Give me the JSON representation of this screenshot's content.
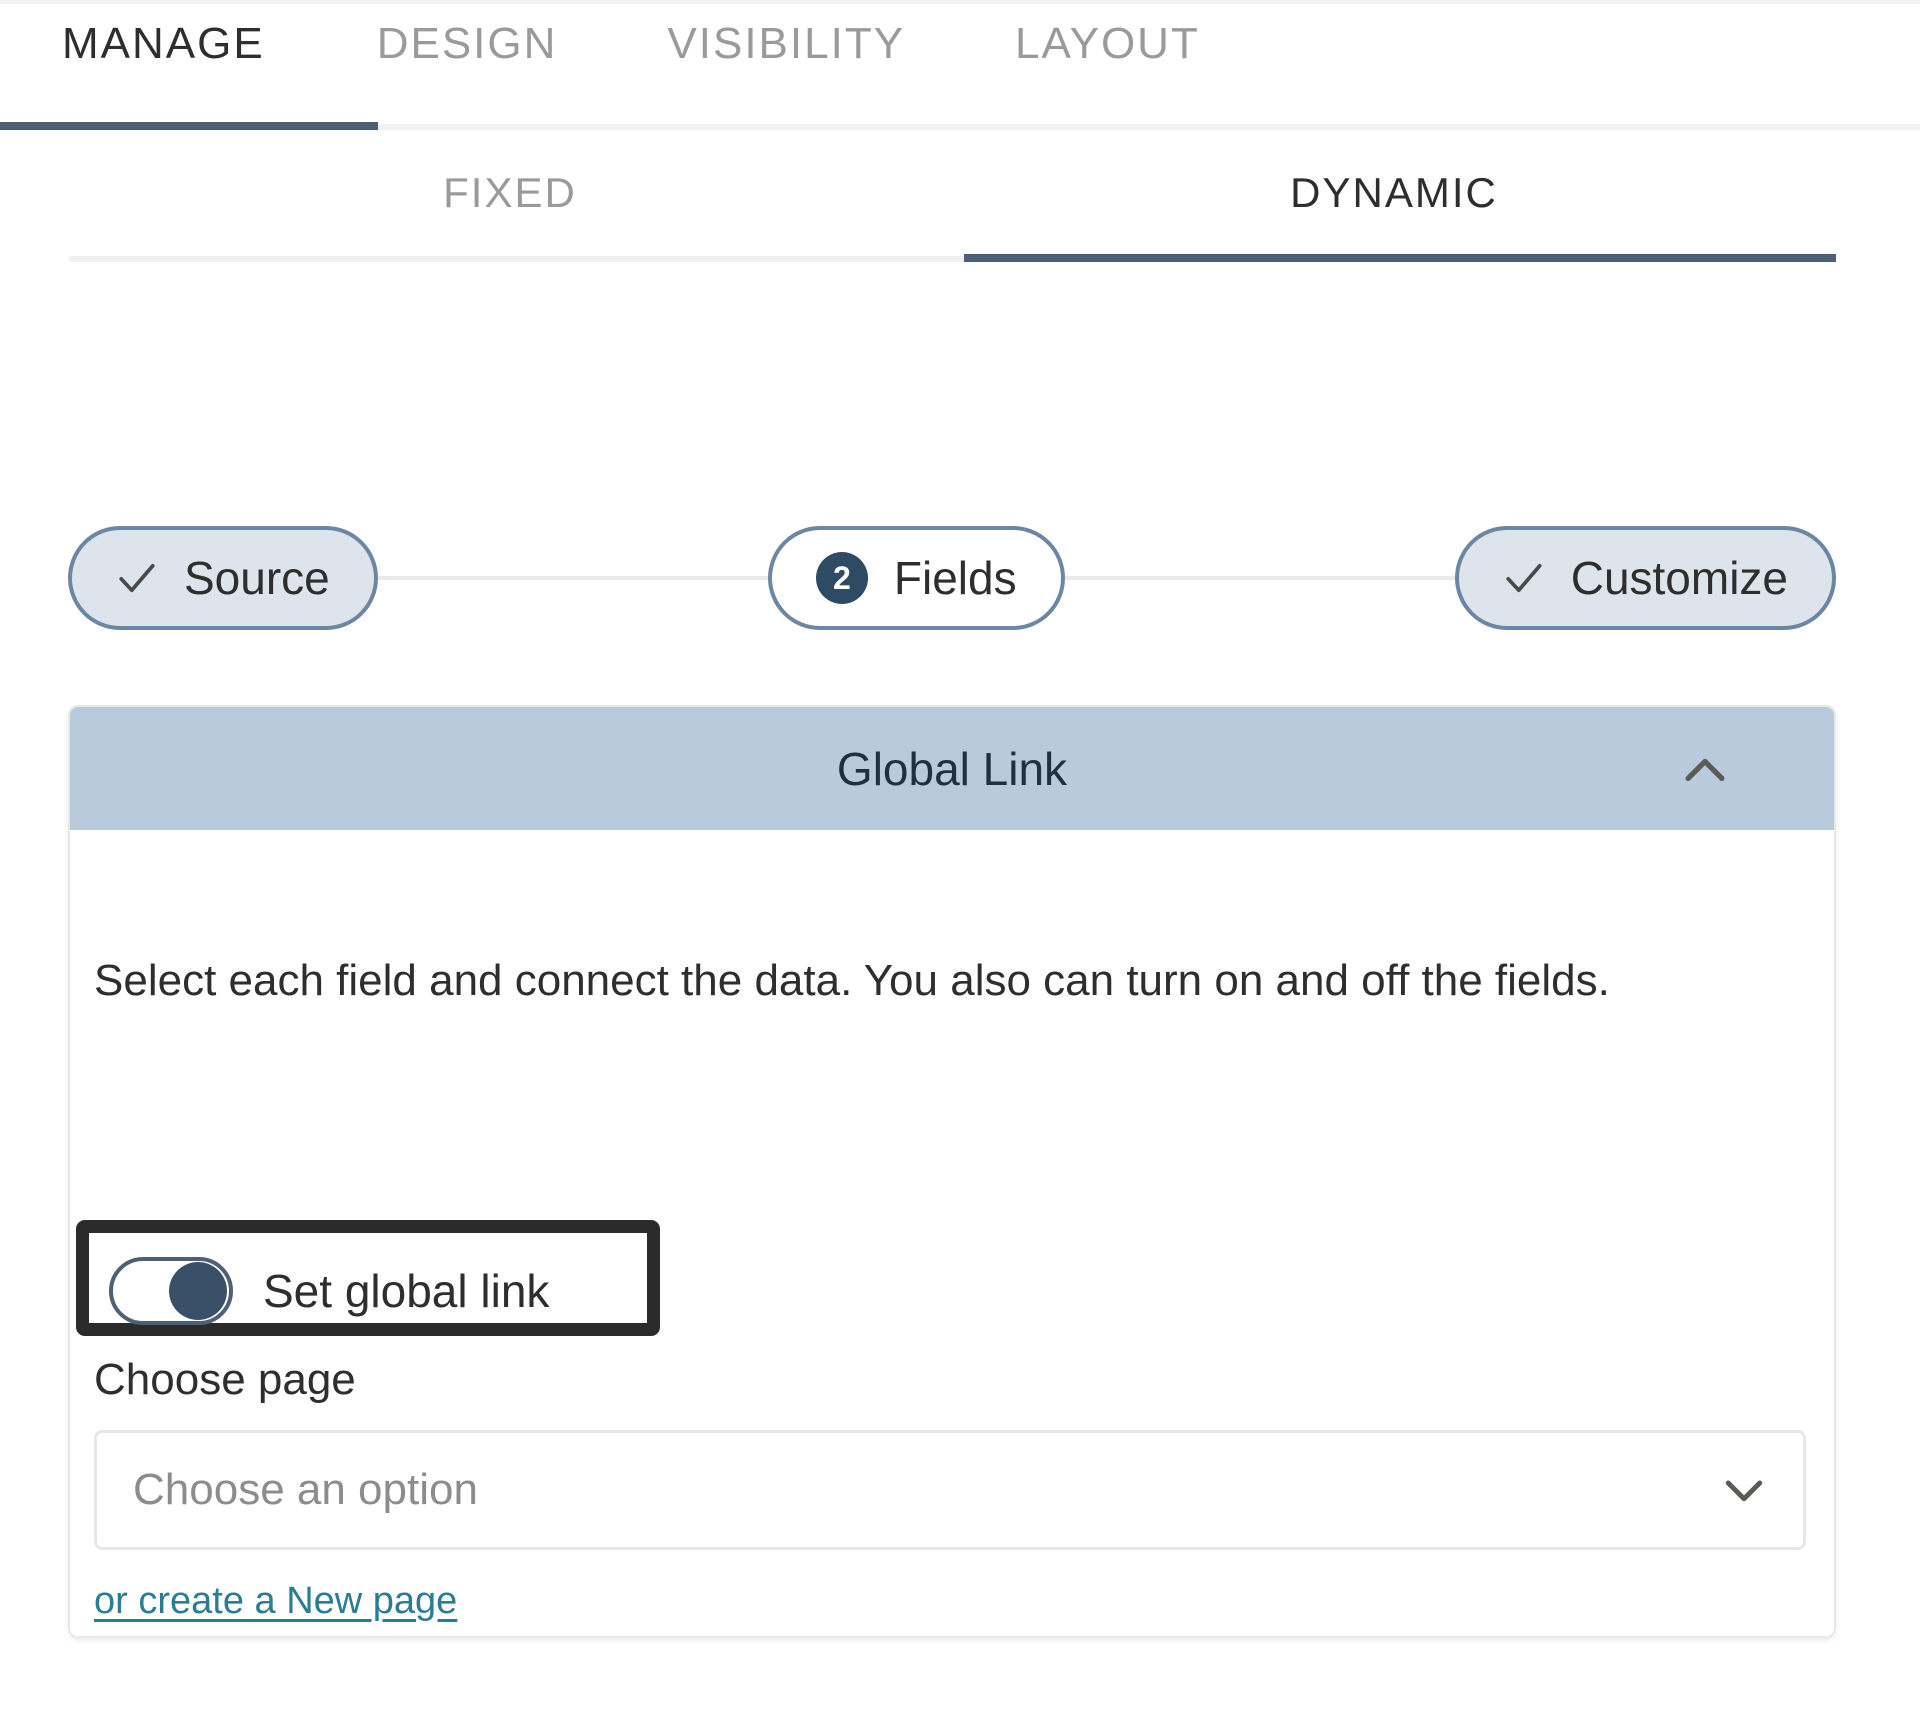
{
  "primary_tabs": [
    {
      "label": "MANAGE",
      "active": true
    },
    {
      "label": "DESIGN",
      "active": false
    },
    {
      "label": "VISIBILITY",
      "active": false
    },
    {
      "label": "LAYOUT",
      "active": false
    }
  ],
  "sub_tabs": [
    {
      "label": "FIXED",
      "active": false
    },
    {
      "label": "DYNAMIC",
      "active": true
    }
  ],
  "stepper": {
    "steps": [
      {
        "label": "Source",
        "state": "done",
        "icon": "check-icon",
        "badge": ""
      },
      {
        "label": "Fields",
        "state": "current",
        "icon": "number-badge",
        "badge": "2"
      },
      {
        "label": "Customize",
        "state": "done",
        "icon": "check-icon",
        "badge": ""
      }
    ]
  },
  "panel": {
    "title": "Global Link",
    "collapse_icon": "chevron-up-icon",
    "description": "Select each field and connect the data. You also can turn on and off the fields.",
    "toggle": {
      "label": "Set global link",
      "state": "on",
      "highlighted": true
    },
    "choose_page": {
      "label": "Choose page",
      "value": "",
      "placeholder": "Choose an option",
      "chevron_icon": "chevron-down-icon"
    },
    "create_link": "or create a New page"
  },
  "colors": {
    "accent_navy": "#4e6076",
    "panel_header_bg": "#b9cadd",
    "step_done_bg": "#dde4ec",
    "badge_bg": "#2f4a63",
    "link_teal": "#2b7d94",
    "highlight_border": "#2b2b2b",
    "muted_text": "#9a9a9a"
  }
}
